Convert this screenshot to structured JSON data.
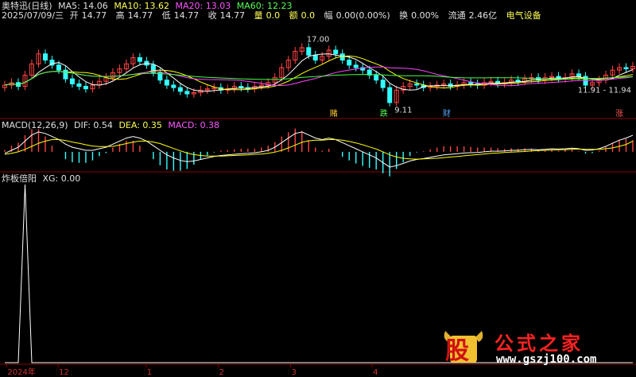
{
  "header": {
    "stock": "奥特迅(日线)",
    "date": "2025/07/09/三",
    "open_label": "开",
    "open": "14.77",
    "high_label": "高",
    "high": "14.77",
    "low_label": "低",
    "low": "14.77",
    "close_label": "收",
    "close": "14.77",
    "vol_label": "量",
    "vol": "0.0",
    "amount_label": "额",
    "amount": "0.0",
    "change_label": "幅",
    "change": "0.00(0.00%)",
    "turnover_label": "换",
    "turnover": "0.00%",
    "float_label": "流通",
    "float": "2.46亿",
    "sector": "电气设备"
  },
  "ma": {
    "ma5": "MA5: 14.06",
    "ma10": "MA10: 13.62",
    "ma20": "MA20: 13.03",
    "ma60": "MA60: 12.23"
  },
  "macd_header": {
    "name": "MACD(12,26,9)",
    "dif": "DIF: 0.54",
    "dea": "DEA: 0.35",
    "macd": "MACD: 0.38"
  },
  "ind_header": {
    "name": "炸板倍阳",
    "xg": "XG: 0.00"
  },
  "annotations": {
    "high": "17.00",
    "low": "9.11",
    "range": "11.91 - 11.94",
    "sig1": "赌",
    "sig2": "跌",
    "sig3": "财",
    "sig4": "涨"
  },
  "axis": {
    "labels": [
      "2024年",
      "12",
      "1",
      "2",
      "3",
      "4"
    ]
  },
  "watermark": {
    "logo": "股",
    "title": "公式之家",
    "url": "www.gszj100.com"
  },
  "colors": {
    "up": "#ff4444",
    "down": "#33ffff",
    "ma5": "#ffffff",
    "ma10": "#ffff00",
    "ma20": "#ff44ff",
    "ma60": "#44ff44",
    "xg": "#ffffff"
  },
  "chart_data": {
    "type": "candlestick",
    "close": [
      12.6,
      12.8,
      12.5,
      13.4,
      14.3,
      15.1,
      14.6,
      14.2,
      13.8,
      13.1,
      12.7,
      12.5,
      12.3,
      12.6,
      12.9,
      13.2,
      13.6,
      13.9,
      14.3,
      14.8,
      14.5,
      14.2,
      13.6,
      13.0,
      12.6,
      12.4,
      12.1,
      11.9,
      12.0,
      12.2,
      12.3,
      12.4,
      12.2,
      12.3,
      12.5,
      12.4,
      12.3,
      12.5,
      12.6,
      12.8,
      13.2,
      14.0,
      14.6,
      15.3,
      15.6,
      15.0,
      14.6,
      14.9,
      15.4,
      15.1,
      14.6,
      14.2,
      14.0,
      13.8,
      13.4,
      13.0,
      12.4,
      11.2,
      12.2,
      12.5,
      12.7,
      12.6,
      12.4,
      12.5,
      12.6,
      12.7,
      12.5,
      12.6,
      12.8,
      12.7,
      12.6,
      12.8,
      12.9,
      12.7,
      12.8,
      13.0,
      12.9,
      13.1,
      13.2,
      13.0,
      13.2,
      13.3,
      13.1,
      13.2,
      13.5,
      13.3,
      12.6,
      12.8,
      13.0,
      13.4,
      13.8,
      14.0,
      13.9,
      14.1
    ],
    "macd_dif": [
      -0.05,
      0.05,
      0.15,
      0.35,
      0.55,
      0.65,
      0.6,
      0.5,
      0.4,
      0.25,
      0.15,
      0.1,
      0.05,
      0.05,
      0.1,
      0.15,
      0.25,
      0.35,
      0.45,
      0.5,
      0.45,
      0.35,
      0.2,
      0.05,
      -0.1,
      -0.2,
      -0.28,
      -0.32,
      -0.3,
      -0.25,
      -0.2,
      -0.15,
      -0.12,
      -0.1,
      -0.08,
      -0.06,
      -0.05,
      -0.03,
      0.0,
      0.05,
      0.15,
      0.3,
      0.45,
      0.6,
      0.65,
      0.55,
      0.45,
      0.4,
      0.45,
      0.4,
      0.3,
      0.2,
      0.1,
      0.0,
      -0.1,
      -0.2,
      -0.35,
      -0.5,
      -0.45,
      -0.38,
      -0.3,
      -0.25,
      -0.22,
      -0.18,
      -0.14,
      -0.1,
      -0.08,
      -0.06,
      -0.04,
      -0.03,
      -0.02,
      0.0,
      0.02,
      0.02,
      0.03,
      0.05,
      0.05,
      0.07,
      0.08,
      0.07,
      0.08,
      0.1,
      0.09,
      0.1,
      0.12,
      0.1,
      0.05,
      0.06,
      0.1,
      0.18,
      0.28,
      0.38,
      0.45,
      0.54
    ],
    "macd_dea": [
      -0.08,
      -0.05,
      0.0,
      0.08,
      0.18,
      0.28,
      0.35,
      0.4,
      0.4,
      0.37,
      0.32,
      0.28,
      0.23,
      0.19,
      0.17,
      0.17,
      0.18,
      0.22,
      0.27,
      0.32,
      0.35,
      0.35,
      0.32,
      0.27,
      0.19,
      0.11,
      0.03,
      -0.04,
      -0.09,
      -0.12,
      -0.14,
      -0.14,
      -0.14,
      -0.13,
      -0.12,
      -0.11,
      -0.1,
      -0.08,
      -0.07,
      -0.05,
      -0.01,
      0.05,
      0.13,
      0.22,
      0.31,
      0.36,
      0.38,
      0.38,
      0.4,
      0.4,
      0.38,
      0.34,
      0.29,
      0.23,
      0.16,
      0.09,
      0.0,
      -0.1,
      -0.17,
      -0.21,
      -0.23,
      -0.24,
      -0.23,
      -0.22,
      -0.21,
      -0.19,
      -0.17,
      -0.15,
      -0.13,
      -0.11,
      -0.09,
      -0.07,
      -0.05,
      -0.04,
      -0.02,
      -0.01,
      0.0,
      0.01,
      0.03,
      0.04,
      0.05,
      0.06,
      0.07,
      0.07,
      0.08,
      0.09,
      0.08,
      0.08,
      0.08,
      0.1,
      0.13,
      0.18,
      0.24,
      0.35
    ],
    "xg": {
      "spike_at": 3,
      "peak": 1.0
    }
  }
}
